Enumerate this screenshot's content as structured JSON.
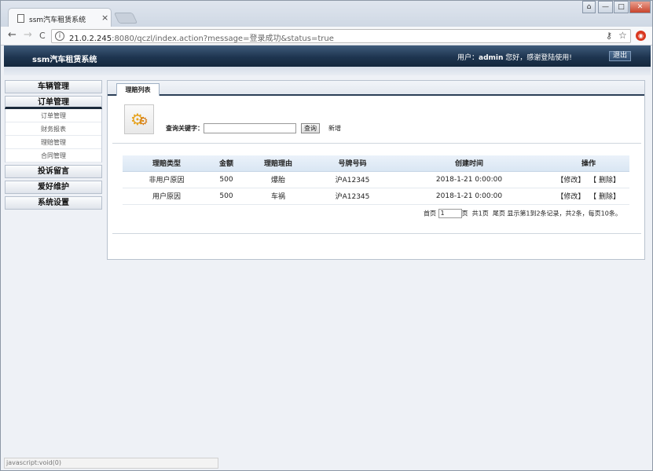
{
  "browser": {
    "tab_title": "ssm汽车租赁系统",
    "tab_close": "×",
    "back": "←",
    "forward": "→",
    "reload": "C",
    "url_host": "21.0.2.245",
    "url_rest": ":8080/qczl/index.action?message=登录成功&status=true",
    "window_min": "—",
    "window_max": "□",
    "window_close": "✕"
  },
  "header": {
    "logo": "ssm汽车租赁系统",
    "user_prefix": "用户：",
    "username": "admin",
    "user_suffix": " 您好，感谢登陆使用!",
    "logout": "退出"
  },
  "sidebar": {
    "menus": [
      {
        "label": "车辆管理"
      },
      {
        "label": "订单管理",
        "items": [
          "订单管理",
          "财务报表",
          "理赔管理",
          "合同管理"
        ]
      },
      {
        "label": "投诉留言"
      },
      {
        "label": "爱好维护"
      },
      {
        "label": "系统设置"
      }
    ]
  },
  "main": {
    "tab": "理赔列表",
    "search_label": "查询关键字：",
    "search_value": "",
    "search_button": "查询",
    "add_link": "新增",
    "columns": [
      "理赔类型",
      "金额",
      "理赔理由",
      "号牌号码",
      "创建时间",
      "操作"
    ],
    "rows": [
      {
        "type": "非用户原因",
        "amount": "500",
        "reason": "爆胎",
        "plate": "沪A12345",
        "created": "2018-1-21 0:00:00",
        "edit": "【修改】",
        "delete": "【 删除】"
      },
      {
        "type": "用户原因",
        "amount": "500",
        "reason": "车祸",
        "plate": "沪A12345",
        "created": "2018-1-21 0:00:00",
        "edit": "【修改】",
        "delete": "【 删除】"
      }
    ],
    "pager": {
      "first": "首页",
      "page_value": "1",
      "page_unit": "页",
      "total_pages": "共1页",
      "last": "尾页",
      "summary": "显示第1到2条记录，共2条，每页10条。"
    }
  },
  "status_bar": "javascript:void(0)"
}
